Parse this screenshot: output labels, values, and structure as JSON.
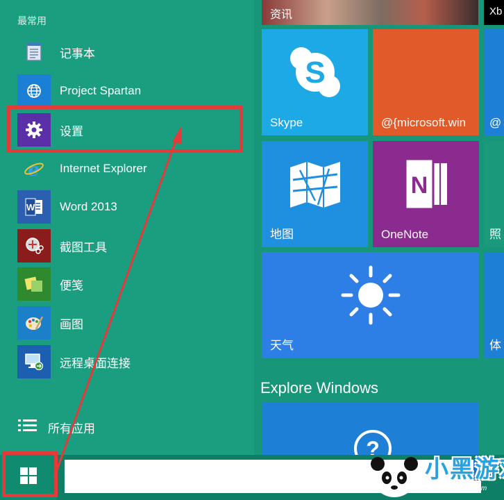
{
  "left_pane": {
    "section_label": "最常用",
    "apps": [
      {
        "label": "记事本",
        "icon": "notepad-icon",
        "icon_bg": "#1b9d7f"
      },
      {
        "label": "Project Spartan",
        "icon": "globe-icon",
        "icon_bg": "#1c7fd6"
      },
      {
        "label": "设置",
        "icon": "gear-icon",
        "icon_bg": "#5a2fa7"
      },
      {
        "label": "Internet Explorer",
        "icon": "ie-icon",
        "icon_bg": "#1b9d7f"
      },
      {
        "label": "Word 2013",
        "icon": "word-icon",
        "icon_bg": "#2b5fb0"
      },
      {
        "label": "截图工具",
        "icon": "snipping-tool-icon",
        "icon_bg": "#8a1c1c"
      },
      {
        "label": "便笺",
        "icon": "sticky-notes-icon",
        "icon_bg": "#2f8a2f"
      },
      {
        "label": "画图",
        "icon": "paint-icon",
        "icon_bg": "#1b7fc9"
      },
      {
        "label": "远程桌面连接",
        "icon": "remote-desktop-icon",
        "icon_bg": "#1c5fb0"
      }
    ],
    "all_apps_label": "所有应用"
  },
  "tiles": {
    "news_label": "资讯",
    "xbox_label": "Xb",
    "skype_label": "Skype",
    "microsoft_label": "@{microsoft.win",
    "edge_label": "@",
    "maps_label": "地图",
    "onenote_label": "OneNote",
    "photos_label": "照",
    "weather_label": "天气",
    "sports_label": "体",
    "explore_heading": "Explore Windows"
  },
  "colors": {
    "background": "#1a9a7b",
    "skype": "#1da8e6",
    "microsoft": "#e05a2a",
    "maps": "#1f8fe0",
    "onenote": "#8b2a8f",
    "weather": "#2d7fe6",
    "explore_tile": "#1e7fd6",
    "highlight": "#e33a3a"
  },
  "taskbar": {
    "search_value": ""
  },
  "watermark": {
    "brand": "小黑游戏",
    "url": "www.xiaohei.com"
  }
}
